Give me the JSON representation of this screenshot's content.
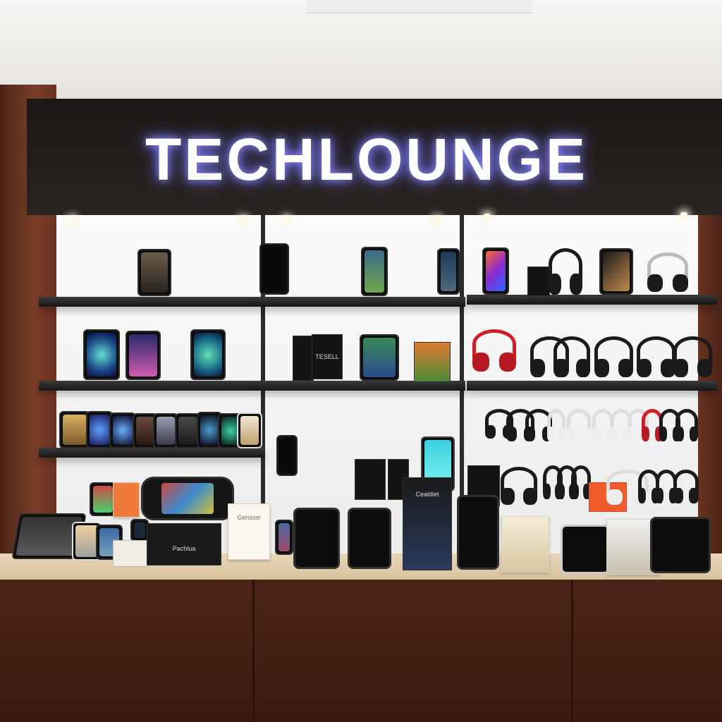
{
  "store": {
    "sign_text": "TECHLOUNGE"
  },
  "displays": {
    "console_box_label": "Pachlua",
    "card_note_label": "Gensssr",
    "phone_box_label": "TESELL",
    "tablet_box_label": "Cealdiet"
  },
  "colors": {
    "sign_glow": "#8c8cff",
    "wood": "#5a2a1b",
    "counter_top": "#e0cba8",
    "red_headphones": "#d11f2a",
    "orange_card": "#ef5b2a"
  }
}
